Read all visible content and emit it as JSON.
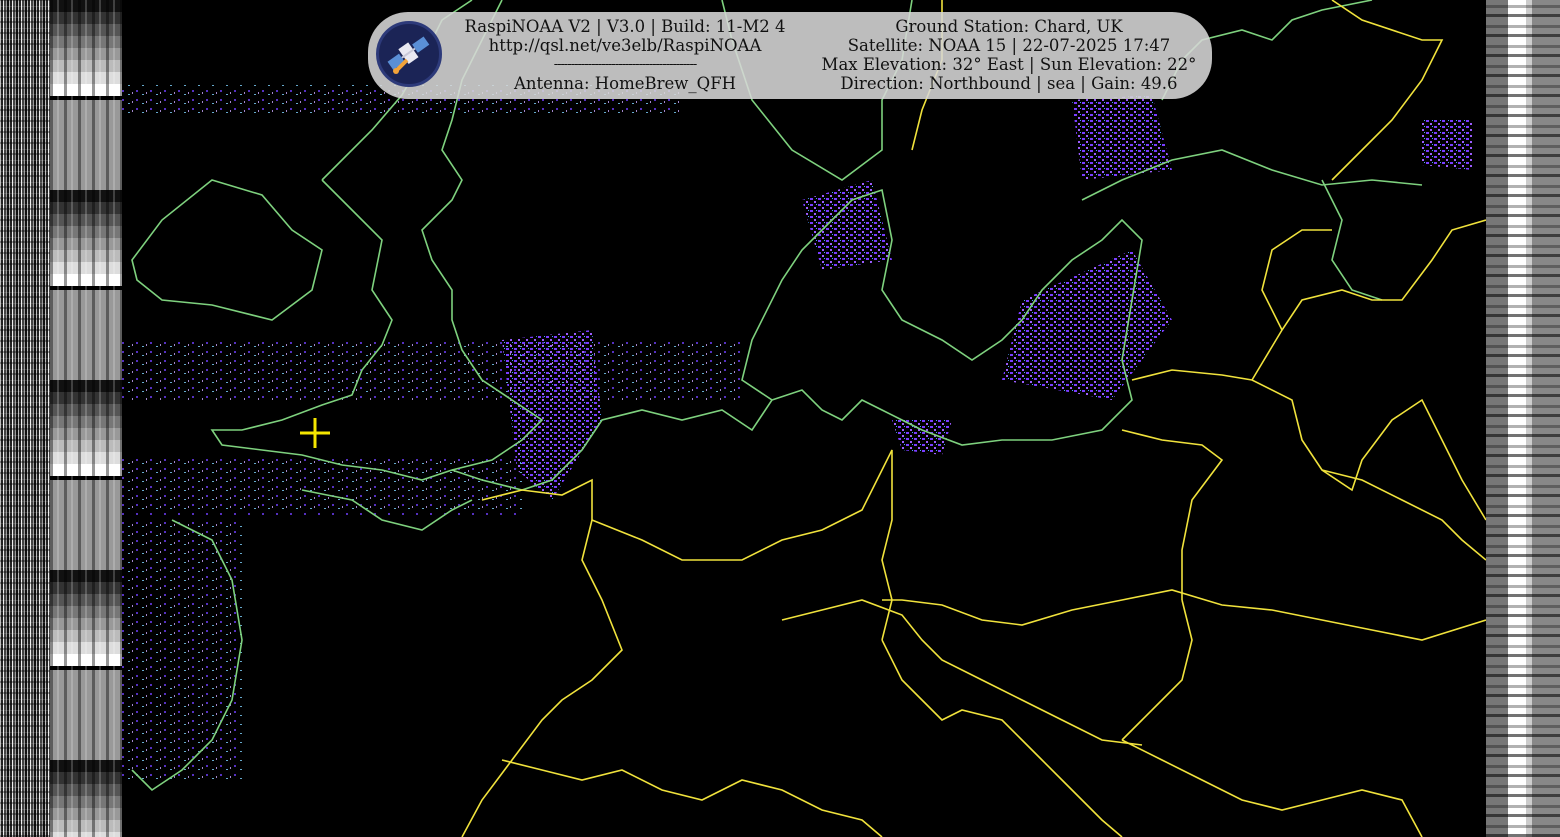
{
  "info": {
    "software": "RaspiNOAA V2 | V3.0 | Build: 11-M2 4",
    "url": "http://qsl.net/ve3elb/RaspiNOAA",
    "separator": "------------------------------------------",
    "antenna": "Antenna: HomeBrew_QFH",
    "ground_station": "Ground Station: Chard, UK",
    "satellite": "Satellite: NOAA 15 | 22-07-2025 17:47",
    "elevation": "Max Elevation: 32° East | Sun Elevation: 22°",
    "direction": "Direction: Northbound | sea | Gain: 49.6"
  },
  "colors": {
    "coastline": "#7ed17e",
    "borders": "#f0e23c",
    "marker": "#f5e600",
    "cloud": "#7a3cff",
    "background": "#000000"
  },
  "icons": {
    "logo": "satellite-icon",
    "marker": "crosshair-marker-icon"
  }
}
